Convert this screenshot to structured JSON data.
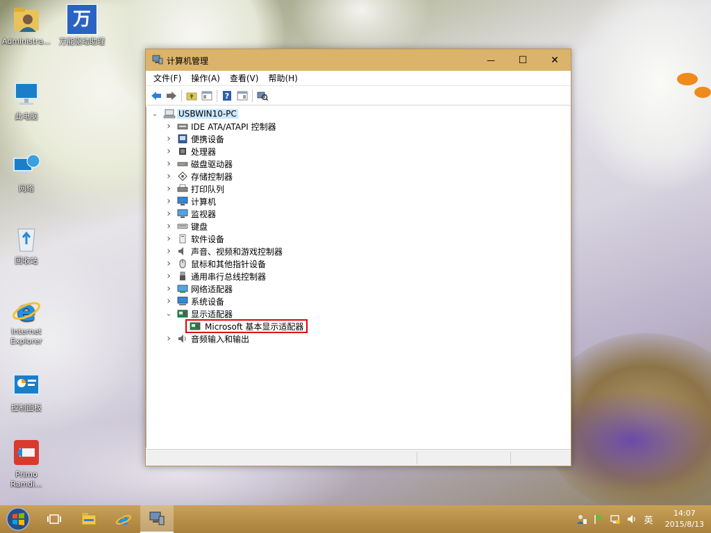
{
  "desktop": {
    "icons": [
      {
        "label": "Administra...",
        "icon": "user-folder-icon"
      },
      {
        "label": "万能驱动助理",
        "icon": "driver-assistant-icon",
        "glyph": "万"
      },
      {
        "label": "此电脑",
        "icon": "this-pc-icon"
      },
      {
        "label": "网络",
        "icon": "network-icon"
      },
      {
        "label": "回收站",
        "icon": "recycle-bin-icon"
      },
      {
        "label": "Internet\nExplorer",
        "label_line1": "Internet",
        "label_line2": "Explorer",
        "icon": "internet-explorer-icon"
      },
      {
        "label": "控制面板",
        "icon": "control-panel-icon"
      },
      {
        "label_line1": "Primo",
        "label_line2": "Ramdi...",
        "icon": "primo-ramdisk-icon"
      }
    ]
  },
  "window": {
    "title": "计算机管理",
    "menu": [
      "文件(F)",
      "操作(A)",
      "查看(V)",
      "帮助(H)"
    ],
    "controls": {
      "minimize": "—",
      "maximize": "☐",
      "close": "✕"
    },
    "tree": {
      "root": "USBWIN10-PC",
      "items": [
        {
          "label": "IDE ATA/ATAPI 控制器",
          "icon": "ide-controller-icon",
          "expanded": false
        },
        {
          "label": "便携设备",
          "icon": "portable-device-icon",
          "expanded": false
        },
        {
          "label": "处理器",
          "icon": "processor-icon",
          "expanded": false
        },
        {
          "label": "磁盘驱动器",
          "icon": "disk-drive-icon",
          "expanded": false
        },
        {
          "label": "存储控制器",
          "icon": "storage-controller-icon",
          "expanded": false
        },
        {
          "label": "打印队列",
          "icon": "print-queue-icon",
          "expanded": false
        },
        {
          "label": "计算机",
          "icon": "computer-icon",
          "expanded": false
        },
        {
          "label": "监视器",
          "icon": "monitor-icon",
          "expanded": false
        },
        {
          "label": "键盘",
          "icon": "keyboard-icon",
          "expanded": false
        },
        {
          "label": "软件设备",
          "icon": "software-device-icon",
          "expanded": false
        },
        {
          "label": "声音、视频和游戏控制器",
          "icon": "sound-icon",
          "expanded": false
        },
        {
          "label": "鼠标和其他指针设备",
          "icon": "mouse-icon",
          "expanded": false
        },
        {
          "label": "通用串行总线控制器",
          "icon": "usb-icon",
          "expanded": false
        },
        {
          "label": "网络适配器",
          "icon": "network-adapter-icon",
          "expanded": false
        },
        {
          "label": "系统设备",
          "icon": "system-device-icon",
          "expanded": false
        },
        {
          "label": "显示适配器",
          "icon": "display-adapter-icon",
          "expanded": true
        },
        {
          "label": "音频输入和输出",
          "icon": "audio-io-icon",
          "expanded": false
        }
      ],
      "child": {
        "label": "Microsoft 基本显示适配器",
        "icon": "display-adapter-icon",
        "highlighted": true
      }
    }
  },
  "taskbar": {
    "tray": {
      "ime": "英"
    },
    "clock": {
      "time": "14:07",
      "date": "2015/8/13"
    }
  },
  "colors": {
    "titlebar": "#dbb36b",
    "taskbar": "#b78f48",
    "highlight_box": "#e00000",
    "root_selected": "#cce8ff"
  }
}
